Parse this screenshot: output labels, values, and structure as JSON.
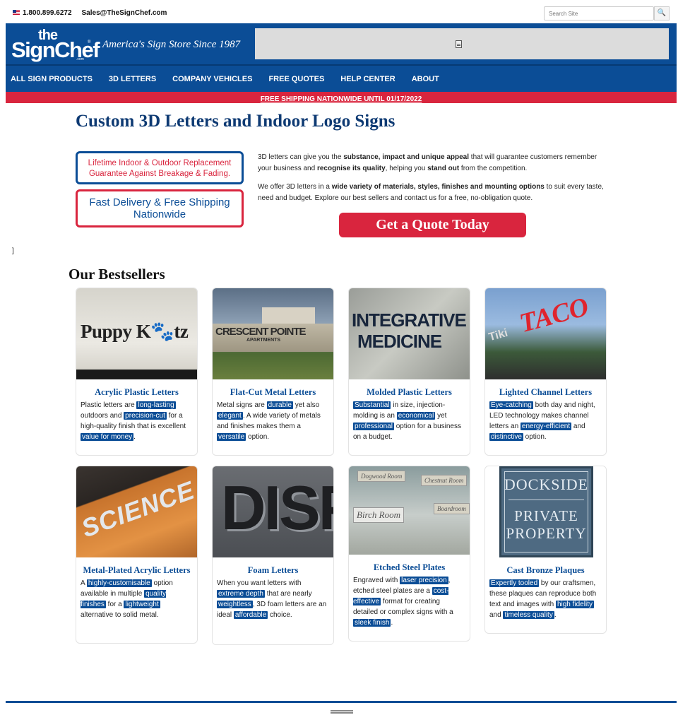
{
  "topbar": {
    "phone": "1.800.899.6272",
    "email": "Sales@TheSignChef.com",
    "search_placeholder": "Search Site",
    "search_icon": "search-icon"
  },
  "header": {
    "logo_the": "the",
    "logo_sign": "SignChef",
    "logo_reg": "®",
    "logo_com": ".com",
    "tagline": "America's Sign Store Since 1987",
    "banner_icon": "document-icon"
  },
  "nav": {
    "items": [
      "ALL SIGN PRODUCTS",
      "3D LETTERS",
      "COMPANY VEHICLES",
      "FREE QUOTES",
      "HELP CENTER",
      "ABOUT"
    ]
  },
  "promo": "FREE SHIPPING NATIONWIDE UNTIL 01/17/2022",
  "main": {
    "title": "Custom 3D Letters and Indoor Logo Signs",
    "badge_guarantee": "Lifetime Indoor & Outdoor Replacement Guarantee Against Breakage & Fading.",
    "badge_delivery": "Fast Delivery & Free Shipping Nationwide",
    "intro1": {
      "a": "3D letters can give you the ",
      "b": "substance, impact and unique appeal",
      "c": " that will guarantee customers remember your business and ",
      "d": "recognise its quality",
      "e": ", helping you ",
      "f": "stand out",
      "g": " from the competition."
    },
    "intro2": {
      "a": "We offer 3D letters in a ",
      "b": "wide variety of materials, styles, finishes and mounting options",
      "c": " to suit every taste, need and budget. Explore our best sellers and contact us for a free, no-obligation quote."
    },
    "cta": "Get a Quote Today",
    "stray": "]",
    "bestsellers_heading": "Our Bestsellers"
  },
  "products": [
    {
      "title": "Acrylic Plastic Letters",
      "image_text": "Puppy K🐾tz",
      "desc": [
        {
          "t": "Plastic letters are "
        },
        {
          "h": "long-lasting"
        },
        {
          "t": " outdoors and "
        },
        {
          "h": "precision-cut"
        },
        {
          "t": " for a high-quality finish that is excellent "
        },
        {
          "h": "value for money"
        },
        {
          "t": "."
        }
      ]
    },
    {
      "title": "Flat-Cut Metal Letters",
      "image_text": "CRESCENT POINTE",
      "image_sub": "APARTMENTS",
      "desc": [
        {
          "t": "Metal signs are "
        },
        {
          "h": "durable"
        },
        {
          "t": " yet also "
        },
        {
          "h": "elegant"
        },
        {
          "t": ". A wide variety of metals and finishes makes them a "
        },
        {
          "h": "versatile"
        },
        {
          "t": " option."
        }
      ]
    },
    {
      "title": "Molded Plastic Letters",
      "image_text": "INTEGRATIVE",
      "image_sub": "MEDICINE",
      "desc": [
        {
          "h": "Substantial"
        },
        {
          "t": " in size, injection-molding is an "
        },
        {
          "h": "economical"
        },
        {
          "t": " yet "
        },
        {
          "h": "professional"
        },
        {
          "t": " option for a business on a budget."
        }
      ]
    },
    {
      "title": "Lighted Channel Letters",
      "image_text": "TACO",
      "image_sub": "Tiki",
      "desc": [
        {
          "h": "Eye-catching"
        },
        {
          "t": " both day and night, LED technology makes channel letters an "
        },
        {
          "h": "energy-efficient"
        },
        {
          "t": " and "
        },
        {
          "h": "distinctive"
        },
        {
          "t": " option."
        }
      ]
    },
    {
      "title": "Metal-Plated Acrylic Letters",
      "image_text": "SCIENCE",
      "desc": [
        {
          "t": "A "
        },
        {
          "h": "highly-customisable"
        },
        {
          "t": " option available in multiple "
        },
        {
          "h": "quality finishes"
        },
        {
          "t": " for a "
        },
        {
          "h": "lightweight"
        },
        {
          "t": " alternative to solid metal."
        }
      ]
    },
    {
      "title": "Foam Letters",
      "image_text": "DISP",
      "desc": [
        {
          "t": "When you want letters with "
        },
        {
          "h": "extreme depth"
        },
        {
          "t": " that are nearly "
        },
        {
          "h": "weightless"
        },
        {
          "t": ", 3D foam letters are an ideal "
        },
        {
          "h": "affordable"
        },
        {
          "t": " choice."
        }
      ]
    },
    {
      "title": "Etched Steel Plates",
      "plates": [
        "Dogwood Room",
        "Chestnut Room",
        "Birch Room",
        "Boardroom"
      ],
      "desc": [
        {
          "t": "Engraved with "
        },
        {
          "h": "laser precision"
        },
        {
          "t": ", etched steel plates are a "
        },
        {
          "h": "cost-effective"
        },
        {
          "t": " format for creating detailed or complex signs with a "
        },
        {
          "h": "sleek finish"
        },
        {
          "t": "."
        }
      ]
    },
    {
      "title": "Cast Bronze Plaques",
      "image_text": "DOCKSIDE",
      "image_sub": "PRIVATE PROPERTY",
      "desc": [
        {
          "h": "Expertly tooled"
        },
        {
          "t": " by our craftsmen, these plaques can reproduce both text and images with "
        },
        {
          "h": "high fidelity"
        },
        {
          "t": " and "
        },
        {
          "h": "timeless quality"
        },
        {
          "t": "."
        }
      ]
    }
  ]
}
